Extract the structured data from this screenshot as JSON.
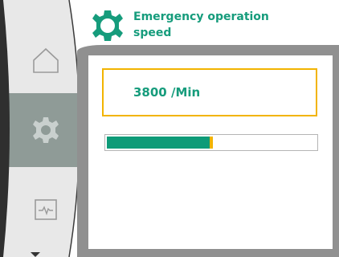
{
  "header": {
    "title_line1": "Emergency operation",
    "title_line2": "speed",
    "icon": "gear-icon"
  },
  "sidebar": {
    "items": [
      {
        "name": "home",
        "icon": "home-icon",
        "active": false
      },
      {
        "name": "settings",
        "icon": "gear-icon",
        "active": true
      },
      {
        "name": "diagnostics",
        "icon": "monitor-icon",
        "active": false
      }
    ],
    "scroll_indicator": "chevron-down-icon"
  },
  "main": {
    "value": "3800 /Min",
    "progress_fraction": 0.5
  },
  "colors": {
    "accent_green": "#169c7c",
    "bar_green": "#0e9b78",
    "highlight_yellow": "#f2b400",
    "panel_gray": "#909090",
    "sidebar_gray": "#e9e9e9",
    "sidebar_active": "#8e9a96"
  }
}
